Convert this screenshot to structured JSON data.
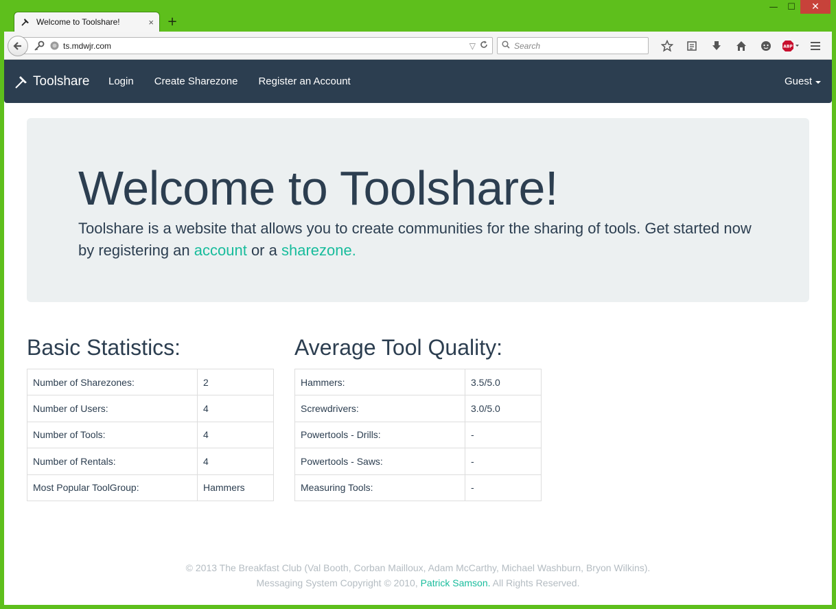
{
  "window": {
    "minimize": "—",
    "maximize": "☐",
    "close": "✕"
  },
  "tab": {
    "title": "Welcome to Toolshare!",
    "favicon": "hammer-icon",
    "close": "×",
    "new_tab": "+"
  },
  "toolbar": {
    "url": "ts.mdwjr.com",
    "search_placeholder": "Search",
    "icons": [
      "star-icon",
      "reading-list-icon",
      "download-icon",
      "home-icon",
      "chat-icon",
      "adblock-icon",
      "menu-icon"
    ]
  },
  "navbar": {
    "brand": "Toolshare",
    "links": [
      "Login",
      "Create Sharezone",
      "Register an Account"
    ],
    "user": "Guest",
    "bg_color": "#2c3e50"
  },
  "jumbotron": {
    "title": "Welcome to Toolshare!",
    "text_before": "Toolshare is a website that allows you to create communities for the sharing of tools. Get started now by registering an ",
    "link_account": "account",
    "text_mid": " or a ",
    "link_sharezone": "sharezone."
  },
  "basic_stats": {
    "title": "Basic Statistics:",
    "rows": [
      {
        "label": "Number of Sharezones:",
        "value": "2"
      },
      {
        "label": "Number of Users:",
        "value": "4"
      },
      {
        "label": "Number of Tools:",
        "value": "4"
      },
      {
        "label": "Number of Rentals:",
        "value": "4"
      },
      {
        "label": "Most Popular ToolGroup:",
        "value": "Hammers"
      }
    ]
  },
  "quality": {
    "title": "Average Tool Quality:",
    "rows": [
      {
        "label": "Hammers:",
        "value": "3.5/5.0"
      },
      {
        "label": "Screwdrivers:",
        "value": "3.0/5.0"
      },
      {
        "label": "Powertools - Drills:",
        "value": "-"
      },
      {
        "label": "Powertools - Saws:",
        "value": "-"
      },
      {
        "label": "Measuring Tools:",
        "value": "-"
      }
    ]
  },
  "footer": {
    "line1": "© 2013 The Breakfast Club (Val Booth, Corban Mailloux, Adam McCarthy, Michael Washburn, Bryon Wilkins).",
    "line2_before": "Messaging System Copyright © 2010, ",
    "line2_link": "Patrick Samson.",
    "line2_after": " All Rights Reserved."
  },
  "colors": {
    "accent": "#18bc9c",
    "primary": "#2c3e50",
    "window_frame": "#5ebf1c"
  }
}
